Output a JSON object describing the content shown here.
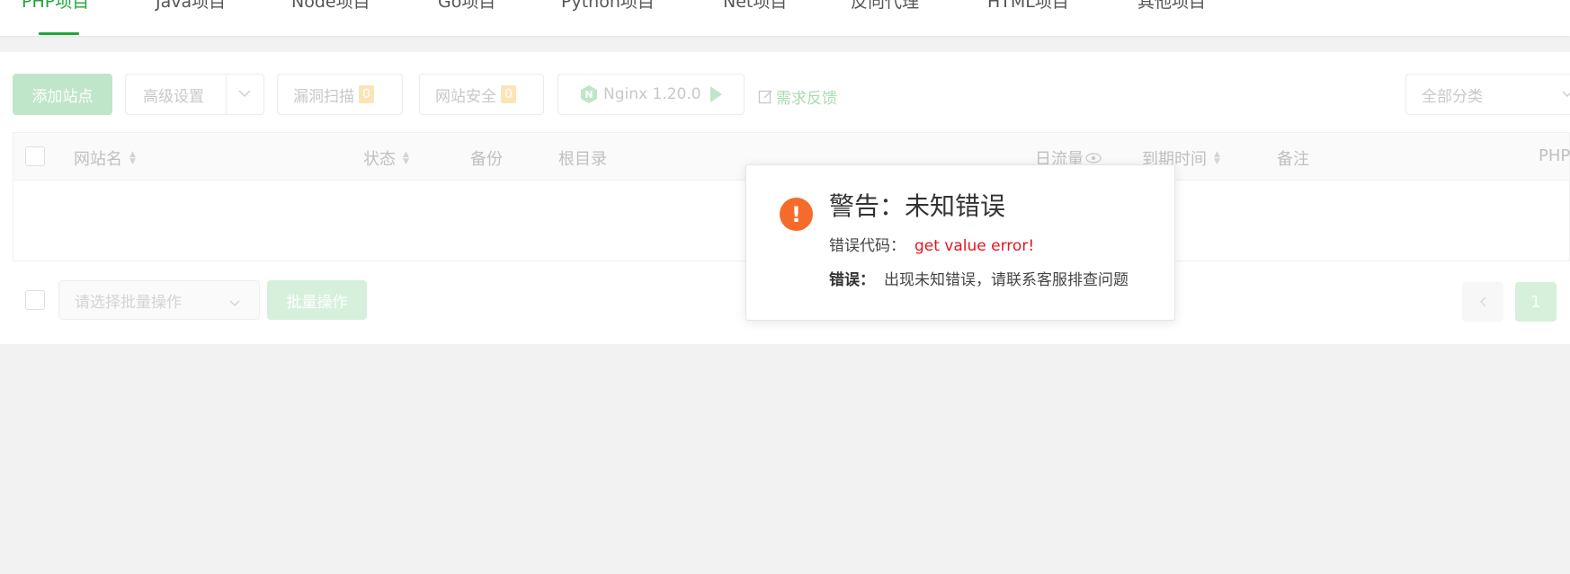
{
  "tabs": [
    {
      "label": "PHP项目",
      "active": true
    },
    {
      "label": "Java项目"
    },
    {
      "label": "Node项目"
    },
    {
      "label": "Go项目"
    },
    {
      "label": "Python项目"
    },
    {
      "label": "Net项目"
    },
    {
      "label": "反向代理"
    },
    {
      "label": "HTML项目"
    },
    {
      "label": "其他项目"
    }
  ],
  "toolbar": {
    "add_site": "添加站点",
    "advanced_settings": "高级设置",
    "vuln_scan": "漏洞扫描",
    "vuln_scan_count": "0",
    "site_security": "网站安全",
    "site_security_count": "0",
    "nginx": "Nginx 1.20.0",
    "feedback": "需求反馈",
    "category_placeholder": "全部分类"
  },
  "table": {
    "columns": [
      "网站名",
      "状态",
      "备份",
      "根目录",
      "日流量",
      "到期时间",
      "备注",
      "PHP"
    ]
  },
  "footer": {
    "batch_placeholder": "请选择批量操作",
    "batch_button": "批量操作",
    "current_page": "1"
  },
  "modal": {
    "title": "警告：未知错误",
    "code_label": "错误代码：",
    "code_value": "get value error!",
    "error_label": "错误：",
    "error_text": "出现未知错误，请联系客服排查问题"
  },
  "colors": {
    "accent": "#20a53a",
    "warning": "#f56c2a",
    "error_text": "#e6161c"
  }
}
